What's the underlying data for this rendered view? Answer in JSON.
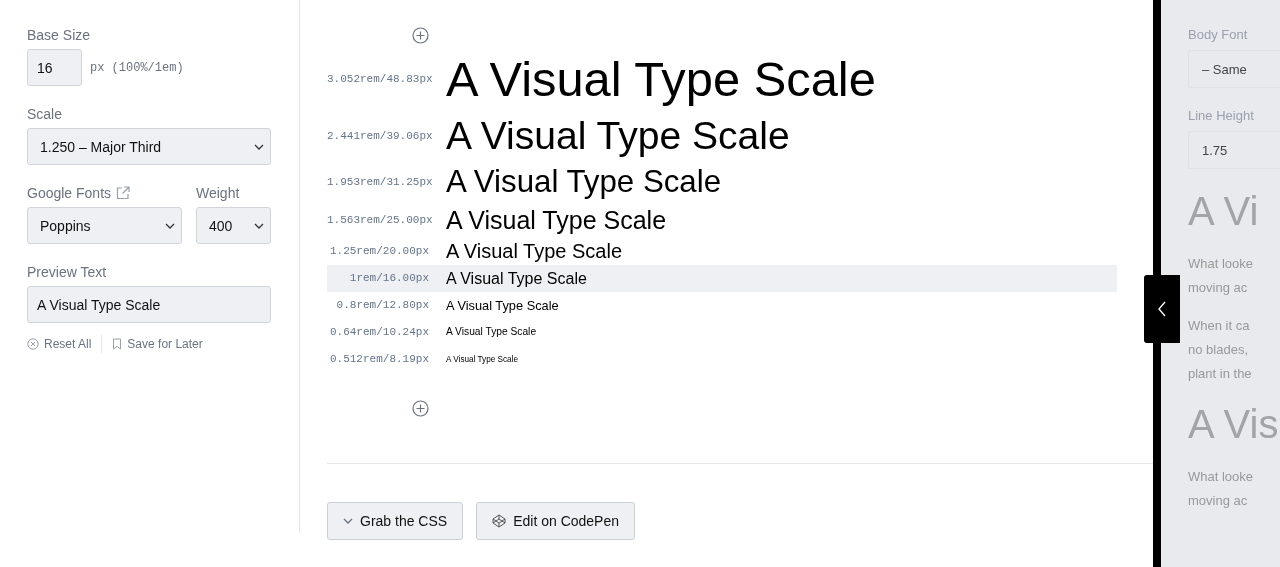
{
  "settings": {
    "base_size": {
      "label": "Base Size",
      "value": "16",
      "unit": "px (100%/1em)"
    },
    "scale": {
      "label": "Scale",
      "value": "1.250 – Major Third"
    },
    "font": {
      "label": "Google Fonts",
      "value": "Poppins"
    },
    "weight": {
      "label": "Weight",
      "value": "400"
    },
    "preview_text": {
      "label": "Preview Text",
      "value": "A Visual Type Scale"
    },
    "actions": [
      "Reset All",
      "Save for Later"
    ]
  },
  "scale_rows": [
    {
      "size": "3.052rem/48.83px",
      "text": "A Visual Type Scale",
      "selected": false
    },
    {
      "size": "2.441rem/39.06px",
      "text": "A Visual Type Scale",
      "selected": false
    },
    {
      "size": "1.953rem/31.25px",
      "text": "A Visual Type Scale",
      "selected": false
    },
    {
      "size": "1.563rem/25.00px",
      "text": "A Visual Type Scale",
      "selected": false
    },
    {
      "size": "1.25rem/20.00px",
      "text": "A Visual Type Scale",
      "selected": false
    },
    {
      "size": "1rem/16.00px",
      "text": "A Visual Type Scale",
      "selected": true
    },
    {
      "size": "0.8rem/12.80px",
      "text": "A Visual Type Scale",
      "selected": false
    },
    {
      "size": "0.64rem/10.24px",
      "text": "A Visual Type Scale",
      "selected": false
    },
    {
      "size": "0.512rem/8.19px",
      "text": "A Visual Type Scale",
      "selected": false
    }
  ],
  "buttons": [
    {
      "kind": "expand",
      "label": "Grab the CSS"
    },
    {
      "kind": "codepen",
      "label": "Edit on CodePen"
    }
  ],
  "side_panel": {
    "body_font": {
      "label": "Body Font",
      "value": "– Same"
    },
    "line_height": {
      "label": "Line Height",
      "value": "1.75"
    },
    "preview": [
      {
        "kind": "heading",
        "text": "A Vi"
      },
      {
        "kind": "paragraph",
        "lines": [
          "What looke",
          "moving ac"
        ]
      },
      {
        "kind": "paragraph",
        "lines": [
          "When it ca",
          "no blades,",
          "plant in the"
        ]
      },
      {
        "kind": "heading",
        "text": "A Vis"
      },
      {
        "kind": "paragraph",
        "lines": [
          "What looke",
          "moving ac"
        ]
      }
    ]
  }
}
